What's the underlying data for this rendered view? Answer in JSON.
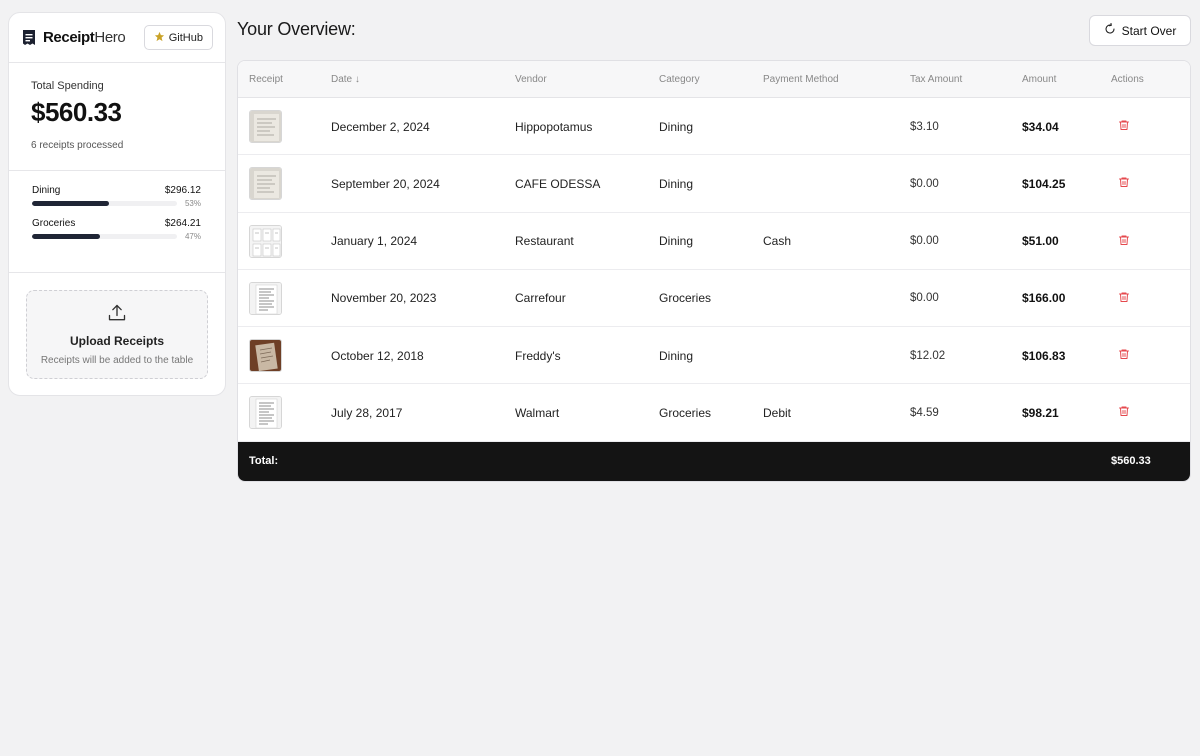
{
  "brand": {
    "name_bold": "Receipt",
    "name_light": "Hero",
    "github_label": "GitHub"
  },
  "summary": {
    "total_label": "Total Spending",
    "total_amount": "$560.33",
    "receipts_processed": "6 receipts processed",
    "categories": [
      {
        "name": "Dining",
        "amount": "$296.12",
        "percent_label": "53%",
        "fraction": 0.53
      },
      {
        "name": "Groceries",
        "amount": "$264.21",
        "percent_label": "47%",
        "fraction": 0.47
      }
    ]
  },
  "upload": {
    "title": "Upload Receipts",
    "subtitle": "Receipts will be added to the table"
  },
  "header": {
    "title": "Your Overview:",
    "start_over_label": "Start Over"
  },
  "table": {
    "columns": [
      "Receipt",
      "Date ↓",
      "Vendor",
      "Category",
      "Payment Method",
      "Tax Amount",
      "Amount",
      "Actions"
    ],
    "rows": [
      {
        "date": "December 2, 2024",
        "vendor": "Hippopotamus",
        "category": "Dining",
        "payment": "",
        "tax": "$3.10",
        "amount": "$34.04",
        "thumb": "paper-light"
      },
      {
        "date": "September 20, 2024",
        "vendor": "CAFE ODESSA",
        "category": "Dining",
        "payment": "",
        "tax": "$0.00",
        "amount": "$104.25",
        "thumb": "paper-light"
      },
      {
        "date": "January 1, 2024",
        "vendor": "Restaurant",
        "category": "Dining",
        "payment": "Cash",
        "tax": "$0.00",
        "amount": "$51.00",
        "thumb": "paper-multi"
      },
      {
        "date": "November 20, 2023",
        "vendor": "Carrefour",
        "category": "Groceries",
        "payment": "",
        "tax": "$0.00",
        "amount": "$166.00",
        "thumb": "paper-lines"
      },
      {
        "date": "October 12, 2018",
        "vendor": "Freddy's",
        "category": "Dining",
        "payment": "",
        "tax": "$12.02",
        "amount": "$106.83",
        "thumb": "paper-brown"
      },
      {
        "date": "July 28, 2017",
        "vendor": "Walmart",
        "category": "Groceries",
        "payment": "Debit",
        "tax": "$4.59",
        "amount": "$98.21",
        "thumb": "paper-lines"
      }
    ],
    "footer_label": "Total:",
    "footer_total": "$560.33"
  },
  "icons": {
    "logo": "receipt-icon",
    "github_star": "star-icon",
    "start_over": "refresh-icon",
    "upload": "upload-icon",
    "delete": "trash-icon"
  },
  "colors": {
    "star": "#c9a227",
    "delete": "#e5484d",
    "bar": "#1f2535",
    "footer": "#141414"
  }
}
